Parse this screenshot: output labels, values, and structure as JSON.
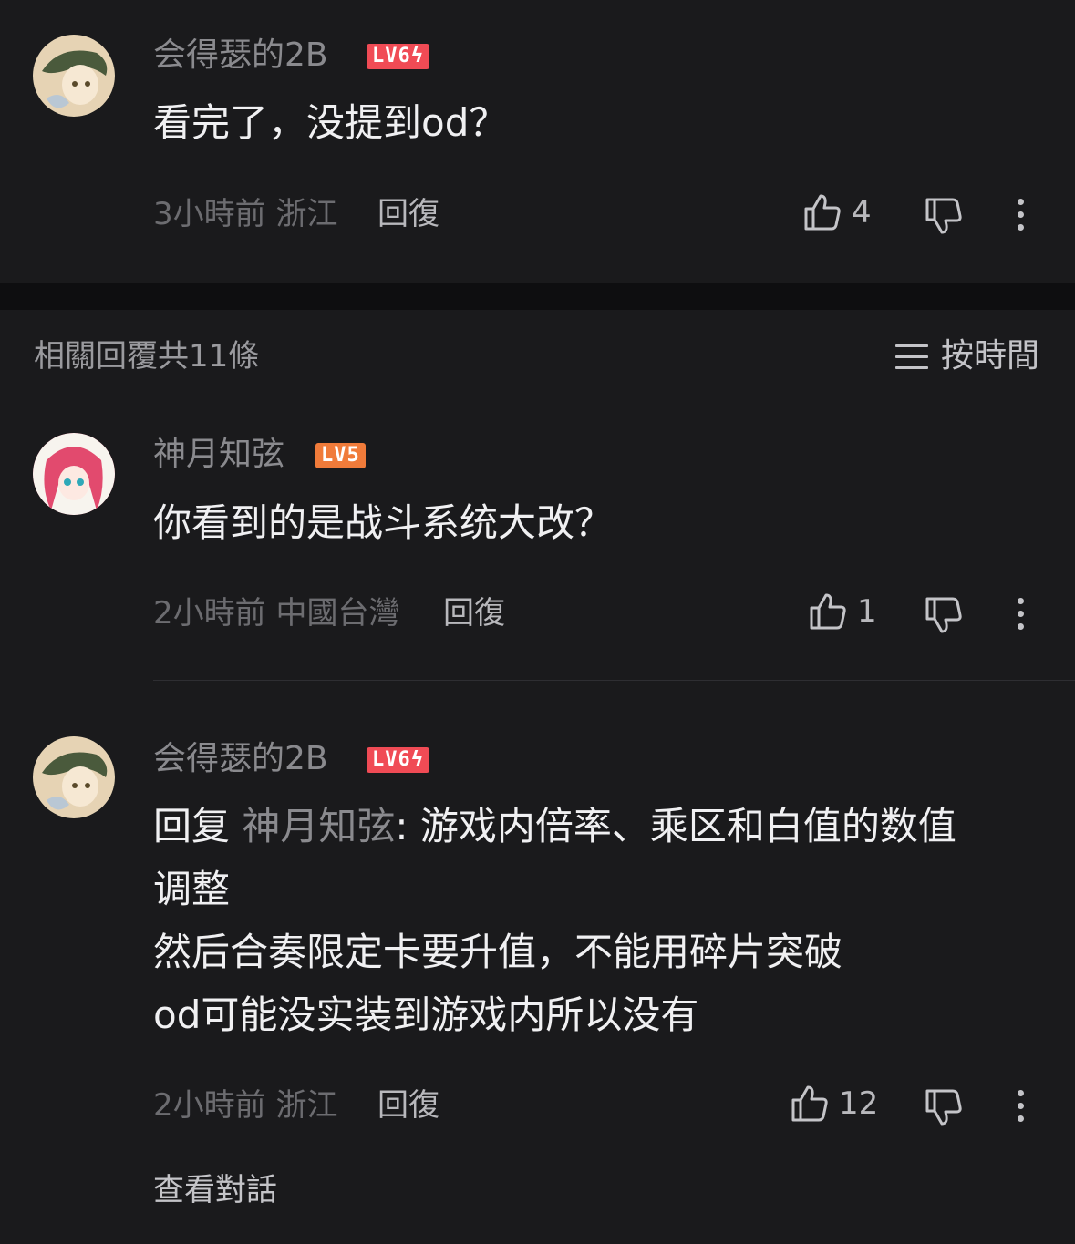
{
  "parent_comment": {
    "username": "会得瑟的2B",
    "level": "LV6",
    "text": "看完了，没提到od？",
    "time": "3小時前",
    "location": "浙江",
    "reply_label": "回復",
    "likes": "4"
  },
  "replies_header": {
    "title": "相關回覆共11條",
    "sort_label": "按時間"
  },
  "replies": [
    {
      "username": "神月知弦",
      "level": "LV5",
      "text_lines": [
        "你看到的是战斗系统大改？"
      ],
      "time": "2小時前",
      "location": "中國台灣",
      "reply_label": "回復",
      "likes": "1"
    },
    {
      "username": "会得瑟的2B",
      "level": "LV6",
      "reply_prefix": "回复 ",
      "reply_target": "神月知弦",
      "first_line_rest": ": 游戏内倍率、乘区和白值的数值",
      "text_lines": [
        "调整",
        "然后合奏限定卡要升值，不能用碎片突破",
        "od可能没实装到游戏内所以没有"
      ],
      "time": "2小時前",
      "location": "浙江",
      "reply_label": "回復",
      "likes": "12"
    }
  ],
  "view_thread_label": "查看對話",
  "colors": {
    "background": "#1a1a1c",
    "level6_badge": "#f04b55",
    "level5_badge": "#f07b3a"
  }
}
